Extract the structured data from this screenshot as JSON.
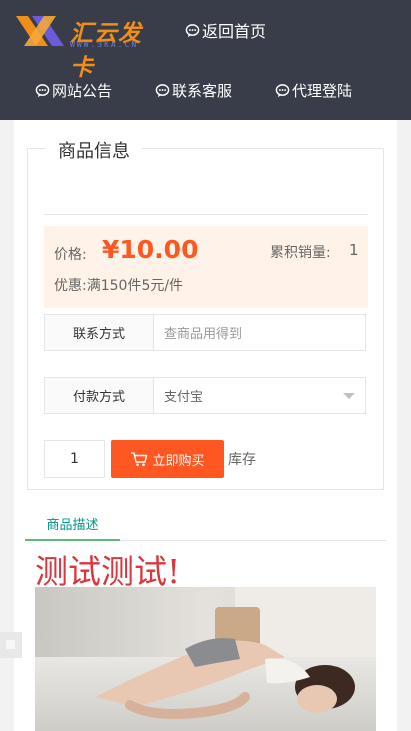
{
  "header": {
    "logo_text": "汇云发卡",
    "logo_sub": "WWW.3KA.CN",
    "home_link": "返回首页",
    "logo_colors": {
      "orange": "#f08e1a",
      "purple": "#6b5bd8"
    }
  },
  "nav": {
    "items": [
      {
        "label": "网站公告",
        "icon": "message-icon"
      },
      {
        "label": "联系客服",
        "icon": "message-icon"
      },
      {
        "label": "代理登陆",
        "icon": "message-icon"
      }
    ]
  },
  "product": {
    "section_title": "商品信息",
    "price_label": "价格:",
    "price": "¥10.00",
    "sales_label": "累积销量:",
    "sales_value": "1",
    "discount": "优惠:满150件5元/件",
    "contact_label": "联系方式",
    "contact_placeholder": "查商品用得到",
    "payment_label": "付款方式",
    "payment_value": "支付宝",
    "quantity": "1",
    "buy_label": "立即购买",
    "stock_label": "库存"
  },
  "tabs": {
    "description_label": "商品描述"
  },
  "description": {
    "heading": "测试测试!"
  },
  "colors": {
    "header_bg": "#393d49",
    "accent": "#ff5722",
    "tab_active": "#009688",
    "heading": "#d9363e"
  }
}
